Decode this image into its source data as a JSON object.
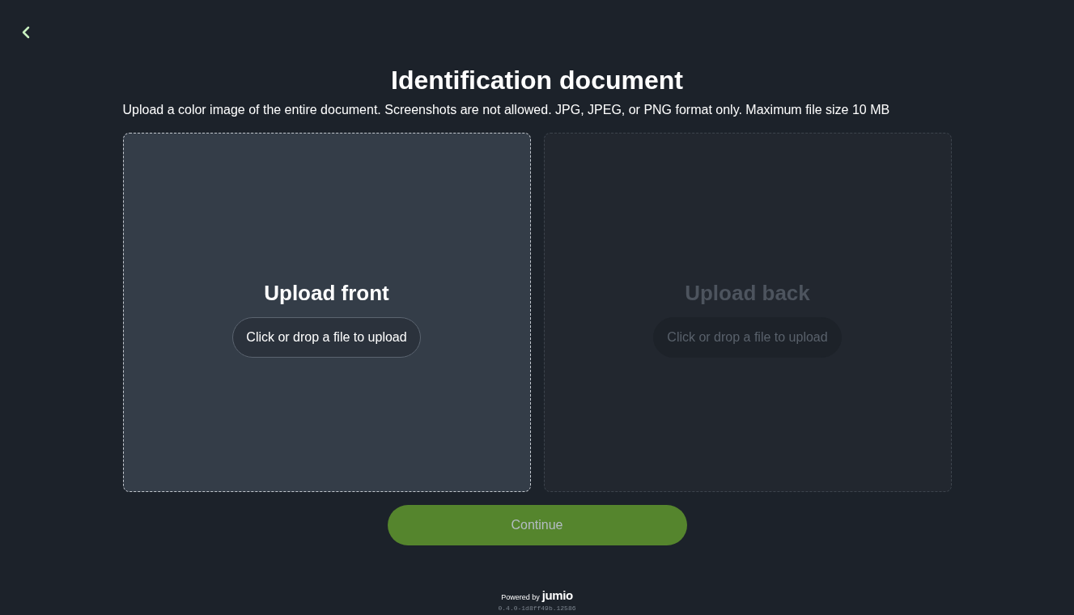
{
  "title": "Identification document",
  "subtitle": "Upload a color image of the entire document. Screenshots are not allowed. JPG, JPEG, or PNG format only. Maximum file size 10 MB",
  "upload_panels": [
    {
      "title": "Upload front",
      "button": "Click or drop a file to upload",
      "disabled": false
    },
    {
      "title": "Upload back",
      "button": "Click or drop a file to upload",
      "disabled": true
    }
  ],
  "continue_button": {
    "label": "Continue",
    "disabled": true
  },
  "footer": {
    "powered_by": "Powered by",
    "brand": "jumio",
    "version": "0.4.0-1d8ff49b.12586"
  }
}
